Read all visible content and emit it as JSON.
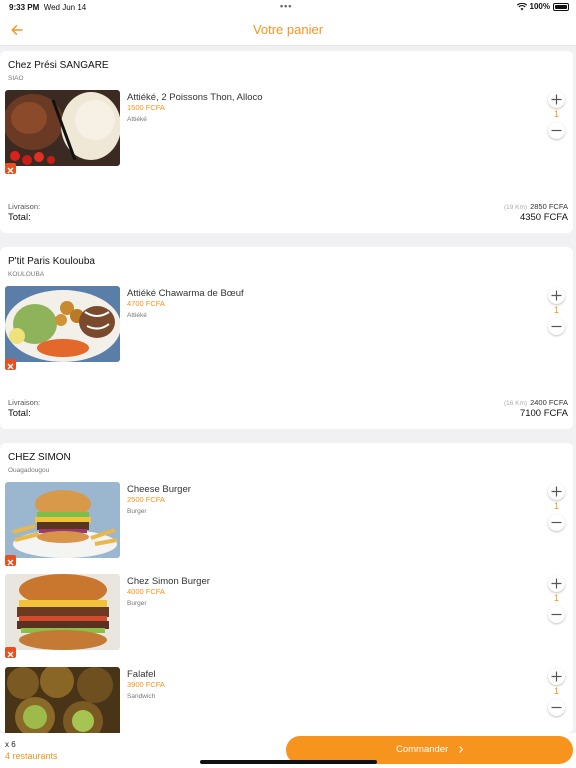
{
  "status_bar": {
    "time": "9:33 PM",
    "date": "Wed Jun 14",
    "battery": "100%"
  },
  "header": {
    "title": "Votre panier"
  },
  "restaurants": [
    {
      "name": "Chez Prési SANGARE",
      "location": "SIAO",
      "items": [
        {
          "name": "Attiéké, 2 Poissons Thon, Alloco",
          "price": "1500 FCFA",
          "category": "Attiéké",
          "qty": "1"
        }
      ],
      "delivery_label": "Livraison:",
      "delivery_distance": "(19 Km)",
      "delivery_fee": "2850  FCFA",
      "total_label": "Total:",
      "total": "4350  FCFA"
    },
    {
      "name": "P'tit Paris Koulouba",
      "location": "KOULOUBA",
      "items": [
        {
          "name": "Attiéké Chawarma de Bœuf",
          "price": "4700 FCFA",
          "category": "Attiéké",
          "qty": "1"
        }
      ],
      "delivery_label": "Livraison:",
      "delivery_distance": "(16 Km)",
      "delivery_fee": "2400  FCFA",
      "total_label": "Total:",
      "total": "7100  FCFA"
    },
    {
      "name": "CHEZ SIMON",
      "location": "Ouagadougou",
      "items": [
        {
          "name": "Cheese Burger",
          "price": "2500 FCFA",
          "category": "Burger",
          "qty": "1"
        },
        {
          "name": "Chez Simon Burger",
          "price": "4000 FCFA",
          "category": "Burger",
          "qty": "1"
        },
        {
          "name": "Falafel",
          "price": "3900 FCFA",
          "category": "Sandwich",
          "qty": "1"
        }
      ]
    }
  ],
  "footer": {
    "count": "x 6",
    "restaurants": "4 restaurants",
    "order_label": "Commander"
  },
  "colors": {
    "accent": "#f7941d",
    "remove": "#e8501f"
  }
}
